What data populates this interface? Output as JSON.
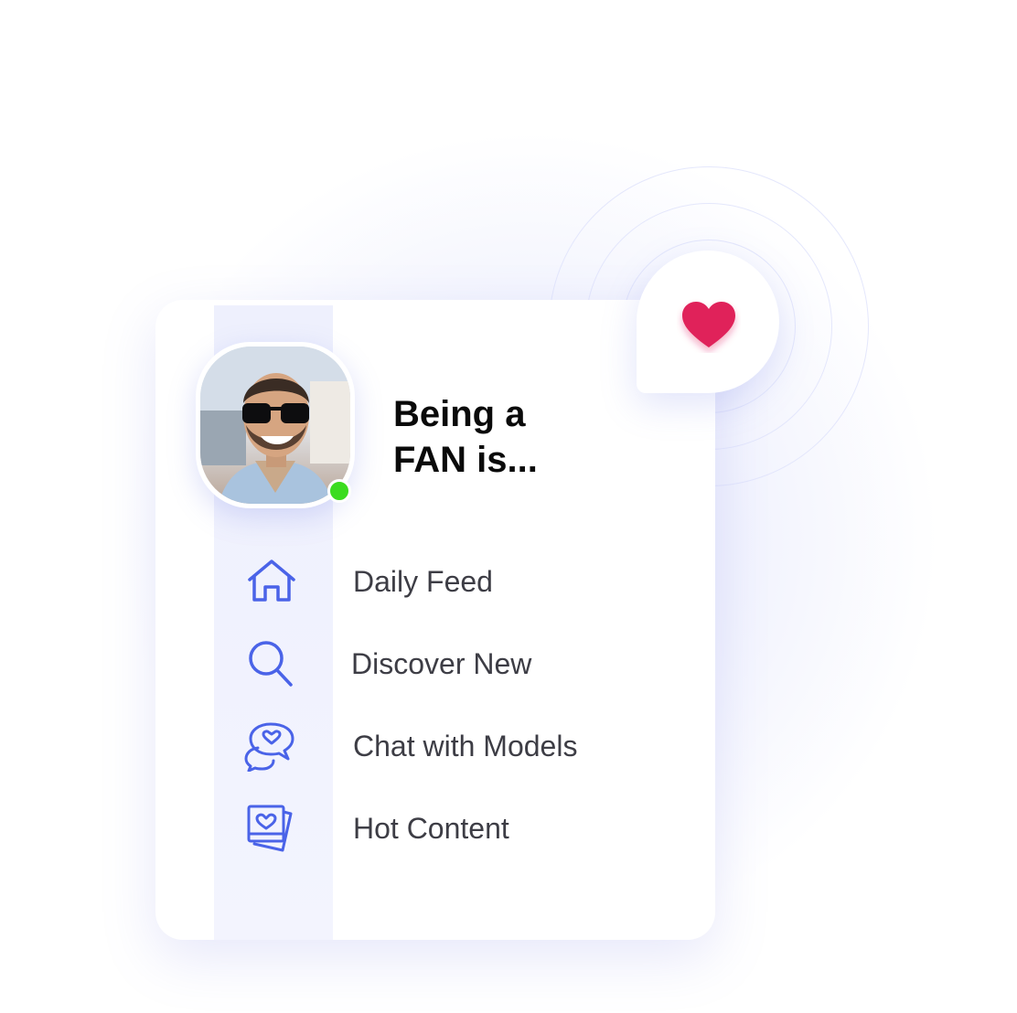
{
  "headline": "Being a\nFAN is...",
  "menu": [
    {
      "label": "Daily Feed",
      "icon": "home-icon"
    },
    {
      "label": "Discover New",
      "icon": "search-icon"
    },
    {
      "label": "Chat with Models",
      "icon": "chat-heart-icon"
    },
    {
      "label": "Hot Content",
      "icon": "photo-heart-icon"
    }
  ],
  "status": "online",
  "colors": {
    "accent": "#4a63e8",
    "heart": "#e0235a",
    "online": "#3bdc1f",
    "text": "#3d3d45",
    "headline": "#0a0a0a"
  }
}
